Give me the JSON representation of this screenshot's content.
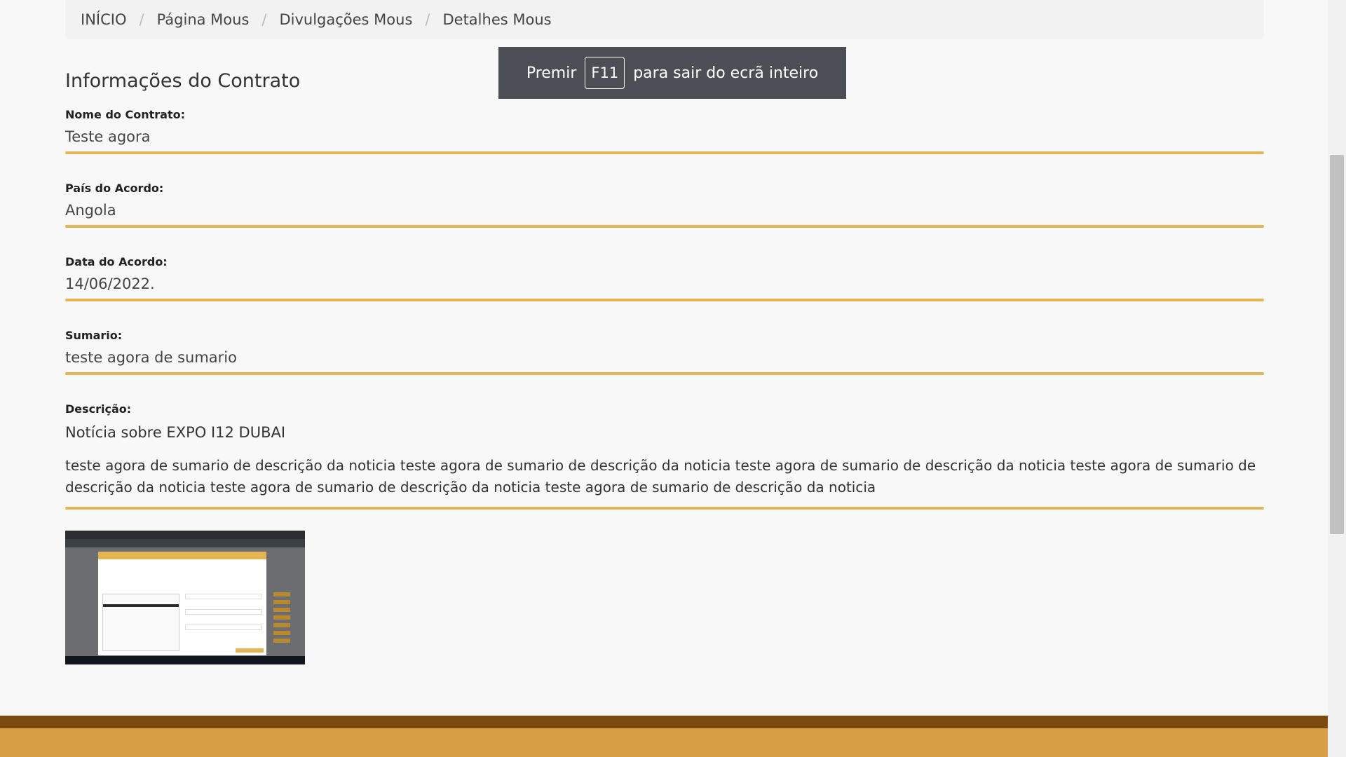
{
  "breadcrumb": {
    "items": [
      "INÍCIO",
      "Página Mous",
      "Divulgações Mous",
      "Detalhes Mous"
    ],
    "separator": "/"
  },
  "section": {
    "title": "Informações do Contrato"
  },
  "fields": {
    "contract_name": {
      "label": "Nome do Contrato:",
      "value": "Teste agora"
    },
    "country": {
      "label": "País do Acordo:",
      "value": "Angola"
    },
    "date": {
      "label": "Data do Acordo:",
      "value": "14/06/2022."
    },
    "summary": {
      "label": "Sumario:",
      "value": "teste agora de sumario"
    },
    "description": {
      "label": "Descrição:",
      "title": "Notícia sobre EXPO I12 DUBAI",
      "body": "teste agora de sumario de descrição da noticia teste agora de sumario de descrição da noticia teste agora de sumario de descrição da noticia teste agora de sumario de descrição da noticia teste agora de sumario de descrição da noticia teste agora de sumario de descrição da noticia"
    }
  },
  "fullscreen_toast": {
    "prefix": "Premir",
    "key": "F11",
    "suffix": "para sair do ecrã inteiro"
  },
  "colors": {
    "accent": "#e6b553",
    "footer": "#d89e46",
    "footer_dark": "#7a4a0e",
    "toast_bg": "#4b4f55"
  },
  "icons": {
    "thumbnail": "screenshot-thumbnail"
  }
}
